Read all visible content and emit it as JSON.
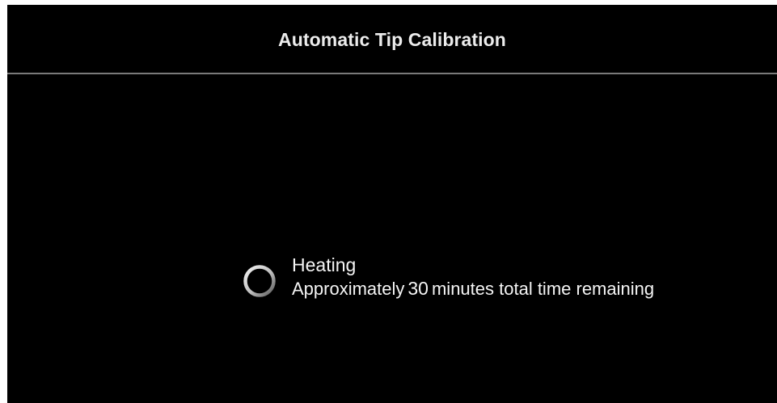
{
  "header": {
    "title": "Automatic Tip Calibration"
  },
  "status": {
    "title": "Heating",
    "prefix": "Approximately",
    "minutes": "30",
    "suffix": "minutes total time remaining"
  },
  "icons": {
    "spinner": "loading-spinner-icon"
  },
  "colors": {
    "background": "#000000",
    "text": "#f5f5f5",
    "divider": "#7a7a7a"
  }
}
